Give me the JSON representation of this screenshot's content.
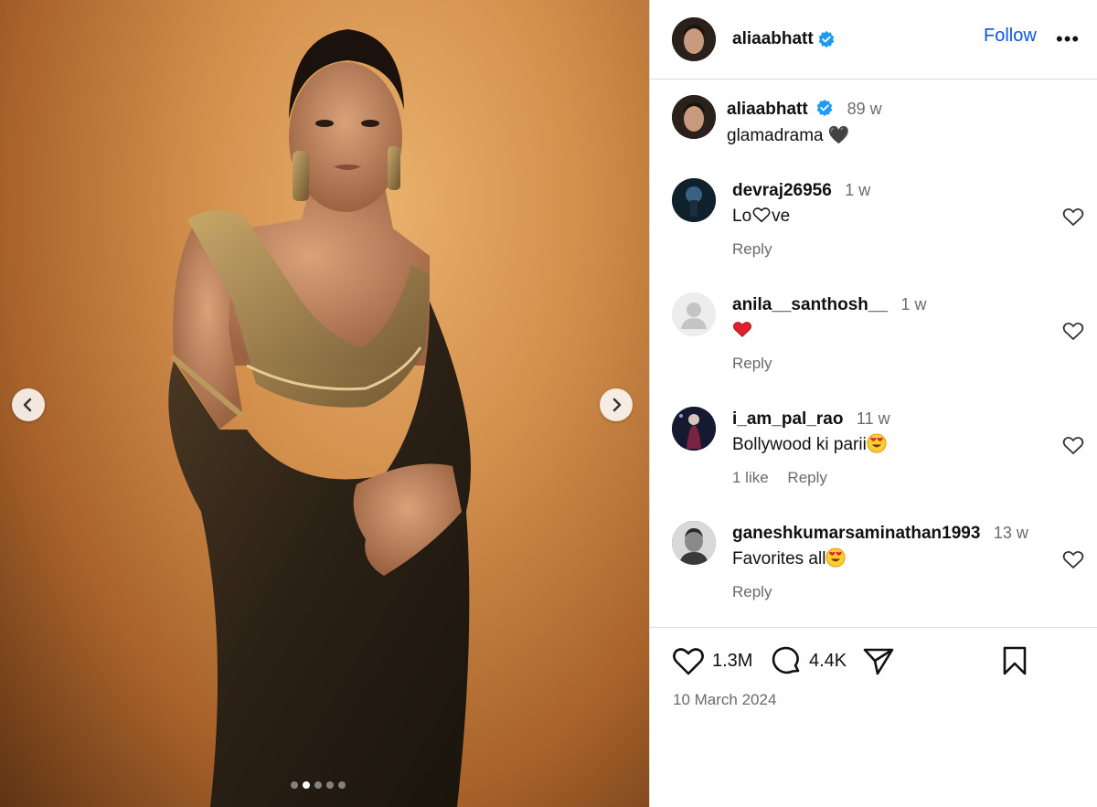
{
  "post": {
    "username": "aliaabhatt",
    "follow_label": "Follow",
    "more_label": "•••",
    "caption": {
      "username": "aliaabhatt",
      "time": "89 w",
      "text": "glamadrama 🖤"
    },
    "carousel": {
      "slides": 5,
      "active_index": 1
    }
  },
  "comments": [
    {
      "username": "devraj26956",
      "time": "1 w",
      "text_before": "Lo",
      "text_after": "ve",
      "inline_emoji": "heart-outline",
      "likes": "",
      "reply_label": "Reply"
    },
    {
      "username": "anila__santhosh__",
      "time": "1 w",
      "text_before": "",
      "text_after": "",
      "inline_emoji": "red-heart",
      "likes": "",
      "reply_label": "Reply"
    },
    {
      "username": "i_am_pal_rao",
      "time": "11 w",
      "text_before": "Bollywood ki parii",
      "text_after": "",
      "inline_emoji": "heart-eyes",
      "likes": "1 like",
      "reply_label": "Reply"
    },
    {
      "username": "ganeshkumarsaminathan1993",
      "time": "13 w",
      "text_before": "Favorites all",
      "text_after": "",
      "inline_emoji": "heart-eyes",
      "likes": "",
      "reply_label": "Reply"
    }
  ],
  "actions": {
    "like_count": "1.3M",
    "comment_count": "4.4K"
  },
  "date": "10 March 2024",
  "colors": {
    "link_blue": "#0a58d6",
    "verified_blue": "#1d9bf0",
    "muted_text": "#6b6b6b",
    "border": "#dbdbdb"
  }
}
